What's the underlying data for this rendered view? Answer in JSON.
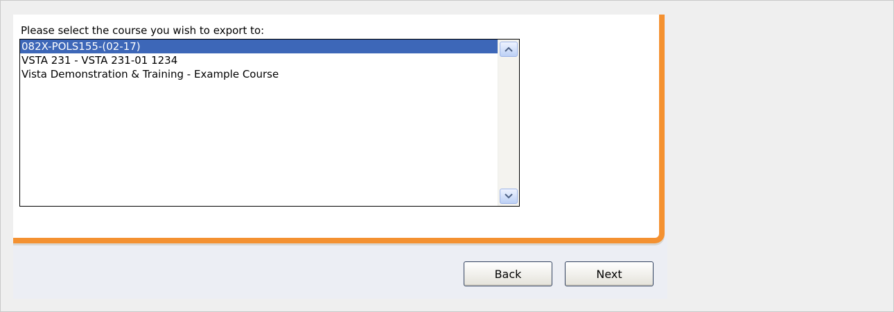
{
  "dialog": {
    "prompt": "Please select the course you wish to export to:",
    "courses": [
      {
        "label": "082X-POLS155-(02-17)",
        "selected": true
      },
      {
        "label": "VSTA 231 - VSTA 231-01 1234",
        "selected": false
      },
      {
        "label": "Vista Demonstration & Training - Example Course",
        "selected": false
      }
    ],
    "buttons": {
      "back_label": "Back",
      "next_label": "Next"
    }
  },
  "colors": {
    "accent": "#f49131",
    "selection": "#3d67b8",
    "panel_bg": "#eceef4"
  },
  "icons": {
    "scroll_up": "chevron-up-icon",
    "scroll_down": "chevron-down-icon"
  }
}
